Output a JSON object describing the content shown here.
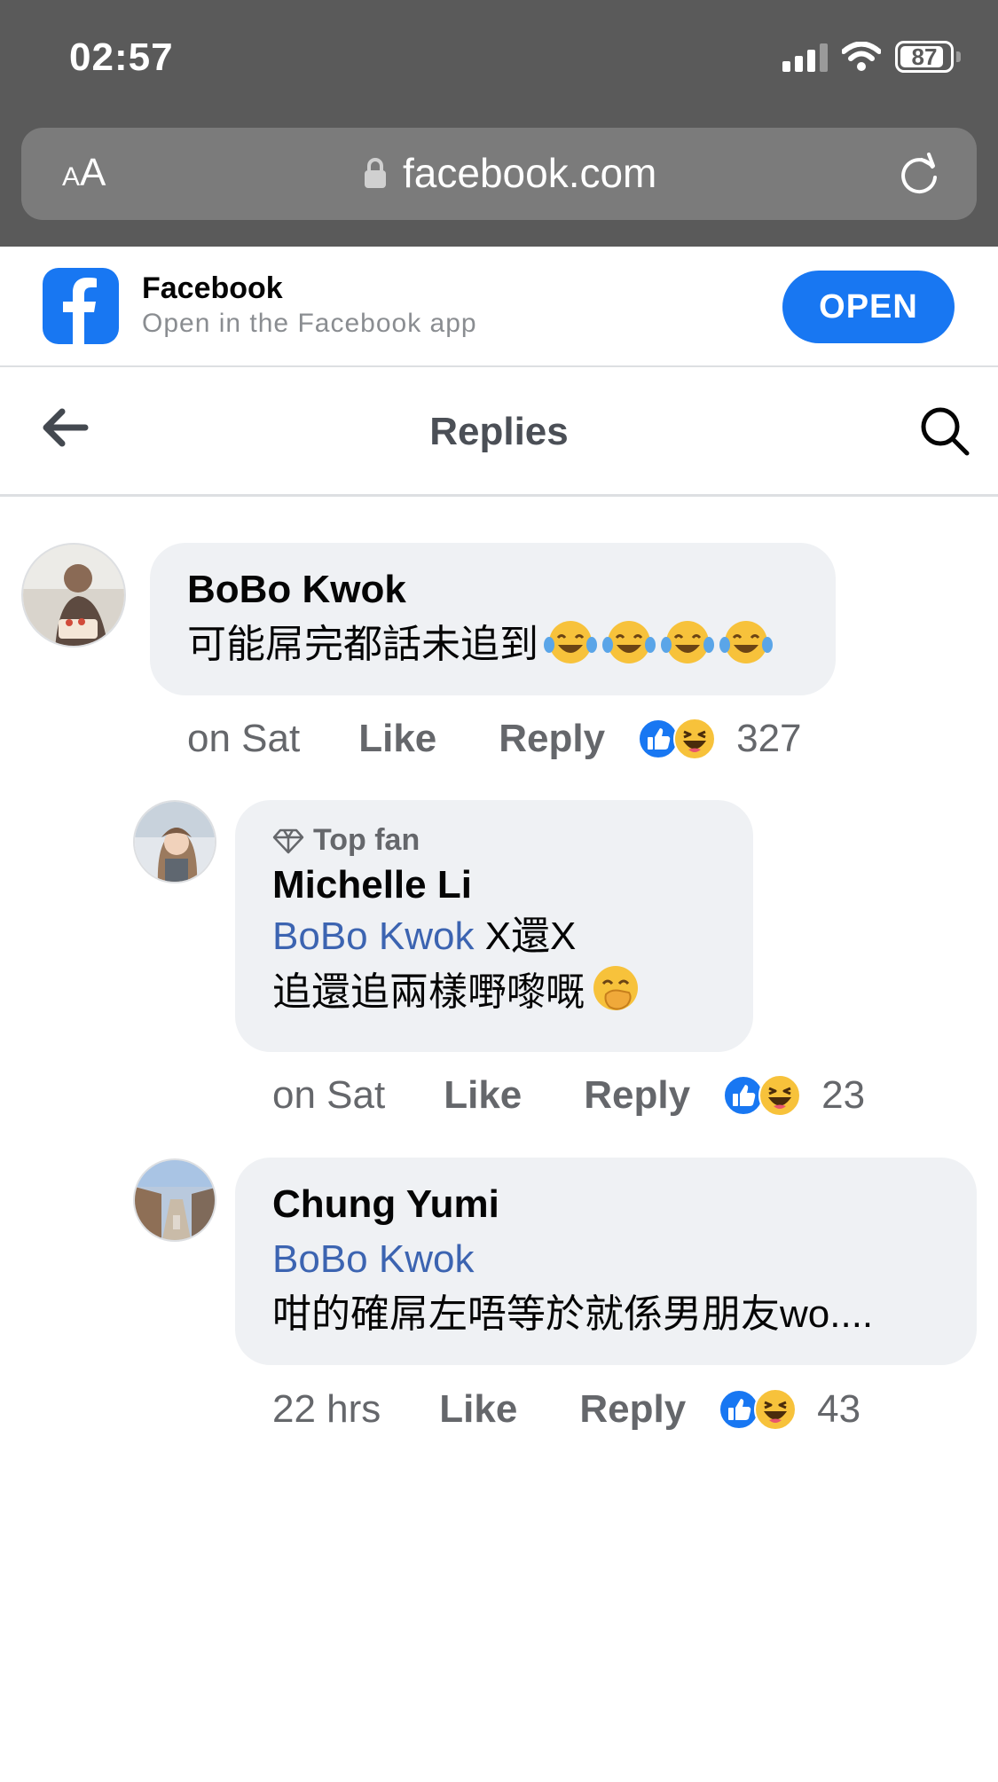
{
  "status": {
    "time": "02:57",
    "battery": "87"
  },
  "browser": {
    "text_size_small": "A",
    "text_size_big": "A",
    "url": "facebook.com"
  },
  "app_banner": {
    "title": "Facebook",
    "subtitle": "Open in the Facebook app",
    "open_label": "OPEN"
  },
  "header": {
    "title": "Replies"
  },
  "comments": [
    {
      "author": "BoBo Kwok",
      "text": "可能屌完都話未追到",
      "emojis": [
        "face-with-tears-of-joy",
        "face-with-tears-of-joy",
        "face-with-tears-of-joy",
        "face-with-tears-of-joy"
      ],
      "time": "on Sat",
      "like_label": "Like",
      "reply_label": "Reply",
      "reaction_count": "327",
      "reactions": [
        "like",
        "haha"
      ]
    },
    {
      "badge": "Top fan",
      "author": "Michelle Li",
      "mention": "BoBo Kwok",
      "text_line1": "X還X",
      "text_line2": "追還追兩樣嘢嚟嘅",
      "emoji": "face-with-hand-over-mouth",
      "time": "on Sat",
      "like_label": "Like",
      "reply_label": "Reply",
      "reaction_count": "23",
      "reactions": [
        "like",
        "haha"
      ]
    },
    {
      "author": "Chung Yumi",
      "mention": "BoBo Kwok",
      "text": "咁的確屌左唔等於就係男朋友wo....",
      "time": "22 hrs",
      "like_label": "Like",
      "reply_label": "Reply",
      "reaction_count": "43",
      "reactions": [
        "like",
        "haha"
      ]
    }
  ],
  "colors": {
    "facebook_blue": "#1877f2",
    "mention_blue": "#3c64b1",
    "bubble_gray": "#eff1f4",
    "meta_gray": "#65676b"
  }
}
